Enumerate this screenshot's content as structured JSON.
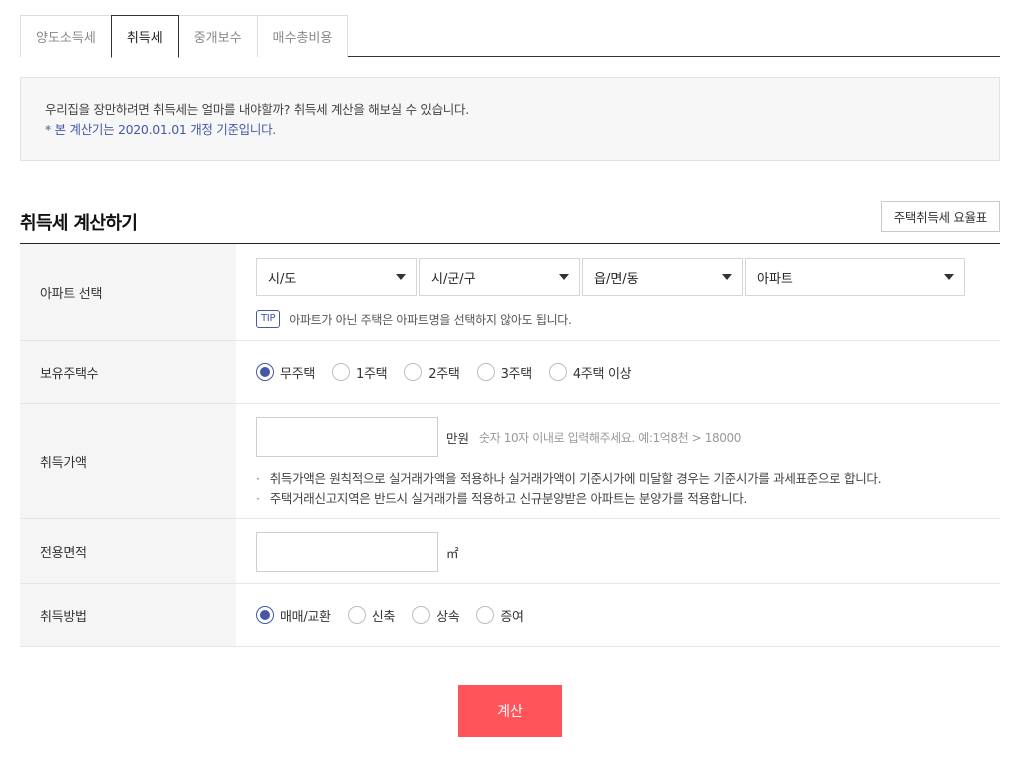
{
  "tabs": [
    {
      "label": "양도소득세",
      "active": false
    },
    {
      "label": "취득세",
      "active": true
    },
    {
      "label": "중개보수",
      "active": false
    },
    {
      "label": "매수총비용",
      "active": false
    }
  ],
  "info": {
    "line1": "우리집을 장만하려면 취득세는 얼마를 내야할까? 취득세 계산을 해보실 수 있습니다.",
    "line2": "* 본 계산기는 2020.01.01 개정 기준입니다."
  },
  "section": {
    "title": "취득세 계산하기",
    "rate_button": "주택취득세 요율표"
  },
  "apartment": {
    "label": "아파트 선택",
    "selects": [
      "시/도",
      "시/군/구",
      "읍/면/동",
      "아파트"
    ],
    "tip_badge": "TIP",
    "tip_text": "아파트가 아닌 주택은 아파트명을 선택하지 않아도 됩니다."
  },
  "houses": {
    "label": "보유주택수",
    "options": [
      "무주택",
      "1주택",
      "2주택",
      "3주택",
      "4주택 이상"
    ],
    "selected": "무주택"
  },
  "price": {
    "label": "취득가액",
    "value": "",
    "unit": "만원",
    "hint": "숫자 10자 이내로 입력해주세요. 예:1억8천 > 18000",
    "notes": [
      "취득가액은 원칙적으로 실거래가액을 적용하나 실거래가액이 기준시가에 미달할 경우는 기준시가를 과세표준으로 합니다.",
      "주택거래신고지역은 반드시 실거래가를 적용하고 신규분양받은 아파트는 분양가를 적용합니다."
    ]
  },
  "area": {
    "label": "전용면적",
    "value": "",
    "unit": "㎡"
  },
  "method": {
    "label": "취득방법",
    "options": [
      "매매/교환",
      "신축",
      "상속",
      "증여"
    ],
    "selected": "매매/교환"
  },
  "calc_button": "계산",
  "colors": {
    "accent": "#4458a6",
    "button": "#ff5459"
  }
}
